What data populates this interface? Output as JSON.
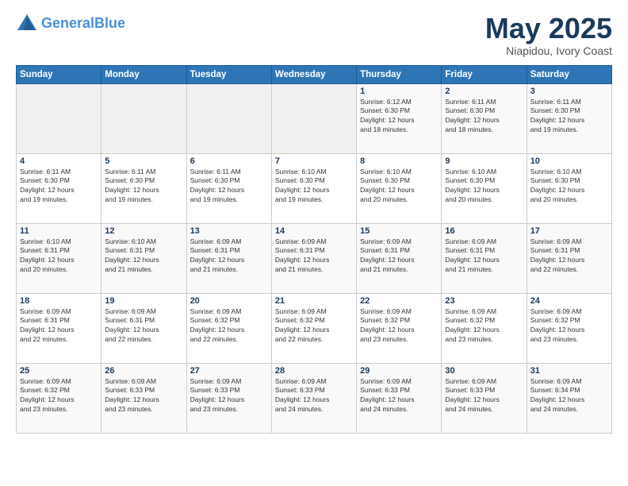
{
  "header": {
    "logo_line1": "General",
    "logo_line2": "Blue",
    "title": "May 2025",
    "location": "Niapidou, Ivory Coast"
  },
  "days_of_week": [
    "Sunday",
    "Monday",
    "Tuesday",
    "Wednesday",
    "Thursday",
    "Friday",
    "Saturday"
  ],
  "weeks": [
    [
      {
        "day": "",
        "info": ""
      },
      {
        "day": "",
        "info": ""
      },
      {
        "day": "",
        "info": ""
      },
      {
        "day": "",
        "info": ""
      },
      {
        "day": "1",
        "info": "Sunrise: 6:12 AM\nSunset: 6:30 PM\nDaylight: 12 hours\nand 18 minutes."
      },
      {
        "day": "2",
        "info": "Sunrise: 6:11 AM\nSunset: 6:30 PM\nDaylight: 12 hours\nand 18 minutes."
      },
      {
        "day": "3",
        "info": "Sunrise: 6:11 AM\nSunset: 6:30 PM\nDaylight: 12 hours\nand 19 minutes."
      }
    ],
    [
      {
        "day": "4",
        "info": "Sunrise: 6:11 AM\nSunset: 6:30 PM\nDaylight: 12 hours\nand 19 minutes."
      },
      {
        "day": "5",
        "info": "Sunrise: 6:11 AM\nSunset: 6:30 PM\nDaylight: 12 hours\nand 19 minutes."
      },
      {
        "day": "6",
        "info": "Sunrise: 6:11 AM\nSunset: 6:30 PM\nDaylight: 12 hours\nand 19 minutes."
      },
      {
        "day": "7",
        "info": "Sunrise: 6:10 AM\nSunset: 6:30 PM\nDaylight: 12 hours\nand 19 minutes."
      },
      {
        "day": "8",
        "info": "Sunrise: 6:10 AM\nSunset: 6:30 PM\nDaylight: 12 hours\nand 20 minutes."
      },
      {
        "day": "9",
        "info": "Sunrise: 6:10 AM\nSunset: 6:30 PM\nDaylight: 12 hours\nand 20 minutes."
      },
      {
        "day": "10",
        "info": "Sunrise: 6:10 AM\nSunset: 6:30 PM\nDaylight: 12 hours\nand 20 minutes."
      }
    ],
    [
      {
        "day": "11",
        "info": "Sunrise: 6:10 AM\nSunset: 6:31 PM\nDaylight: 12 hours\nand 20 minutes."
      },
      {
        "day": "12",
        "info": "Sunrise: 6:10 AM\nSunset: 6:31 PM\nDaylight: 12 hours\nand 21 minutes."
      },
      {
        "day": "13",
        "info": "Sunrise: 6:09 AM\nSunset: 6:31 PM\nDaylight: 12 hours\nand 21 minutes."
      },
      {
        "day": "14",
        "info": "Sunrise: 6:09 AM\nSunset: 6:31 PM\nDaylight: 12 hours\nand 21 minutes."
      },
      {
        "day": "15",
        "info": "Sunrise: 6:09 AM\nSunset: 6:31 PM\nDaylight: 12 hours\nand 21 minutes."
      },
      {
        "day": "16",
        "info": "Sunrise: 6:09 AM\nSunset: 6:31 PM\nDaylight: 12 hours\nand 21 minutes."
      },
      {
        "day": "17",
        "info": "Sunrise: 6:09 AM\nSunset: 6:31 PM\nDaylight: 12 hours\nand 22 minutes."
      }
    ],
    [
      {
        "day": "18",
        "info": "Sunrise: 6:09 AM\nSunset: 6:31 PM\nDaylight: 12 hours\nand 22 minutes."
      },
      {
        "day": "19",
        "info": "Sunrise: 6:09 AM\nSunset: 6:31 PM\nDaylight: 12 hours\nand 22 minutes."
      },
      {
        "day": "20",
        "info": "Sunrise: 6:09 AM\nSunset: 6:32 PM\nDaylight: 12 hours\nand 22 minutes."
      },
      {
        "day": "21",
        "info": "Sunrise: 6:09 AM\nSunset: 6:32 PM\nDaylight: 12 hours\nand 22 minutes."
      },
      {
        "day": "22",
        "info": "Sunrise: 6:09 AM\nSunset: 6:32 PM\nDaylight: 12 hours\nand 23 minutes."
      },
      {
        "day": "23",
        "info": "Sunrise: 6:09 AM\nSunset: 6:32 PM\nDaylight: 12 hours\nand 23 minutes."
      },
      {
        "day": "24",
        "info": "Sunrise: 6:09 AM\nSunset: 6:32 PM\nDaylight: 12 hours\nand 23 minutes."
      }
    ],
    [
      {
        "day": "25",
        "info": "Sunrise: 6:09 AM\nSunset: 6:32 PM\nDaylight: 12 hours\nand 23 minutes."
      },
      {
        "day": "26",
        "info": "Sunrise: 6:09 AM\nSunset: 6:33 PM\nDaylight: 12 hours\nand 23 minutes."
      },
      {
        "day": "27",
        "info": "Sunrise: 6:09 AM\nSunset: 6:33 PM\nDaylight: 12 hours\nand 23 minutes."
      },
      {
        "day": "28",
        "info": "Sunrise: 6:09 AM\nSunset: 6:33 PM\nDaylight: 12 hours\nand 24 minutes."
      },
      {
        "day": "29",
        "info": "Sunrise: 6:09 AM\nSunset: 6:33 PM\nDaylight: 12 hours\nand 24 minutes."
      },
      {
        "day": "30",
        "info": "Sunrise: 6:09 AM\nSunset: 6:33 PM\nDaylight: 12 hours\nand 24 minutes."
      },
      {
        "day": "31",
        "info": "Sunrise: 6:09 AM\nSunset: 6:34 PM\nDaylight: 12 hours\nand 24 minutes."
      }
    ]
  ]
}
